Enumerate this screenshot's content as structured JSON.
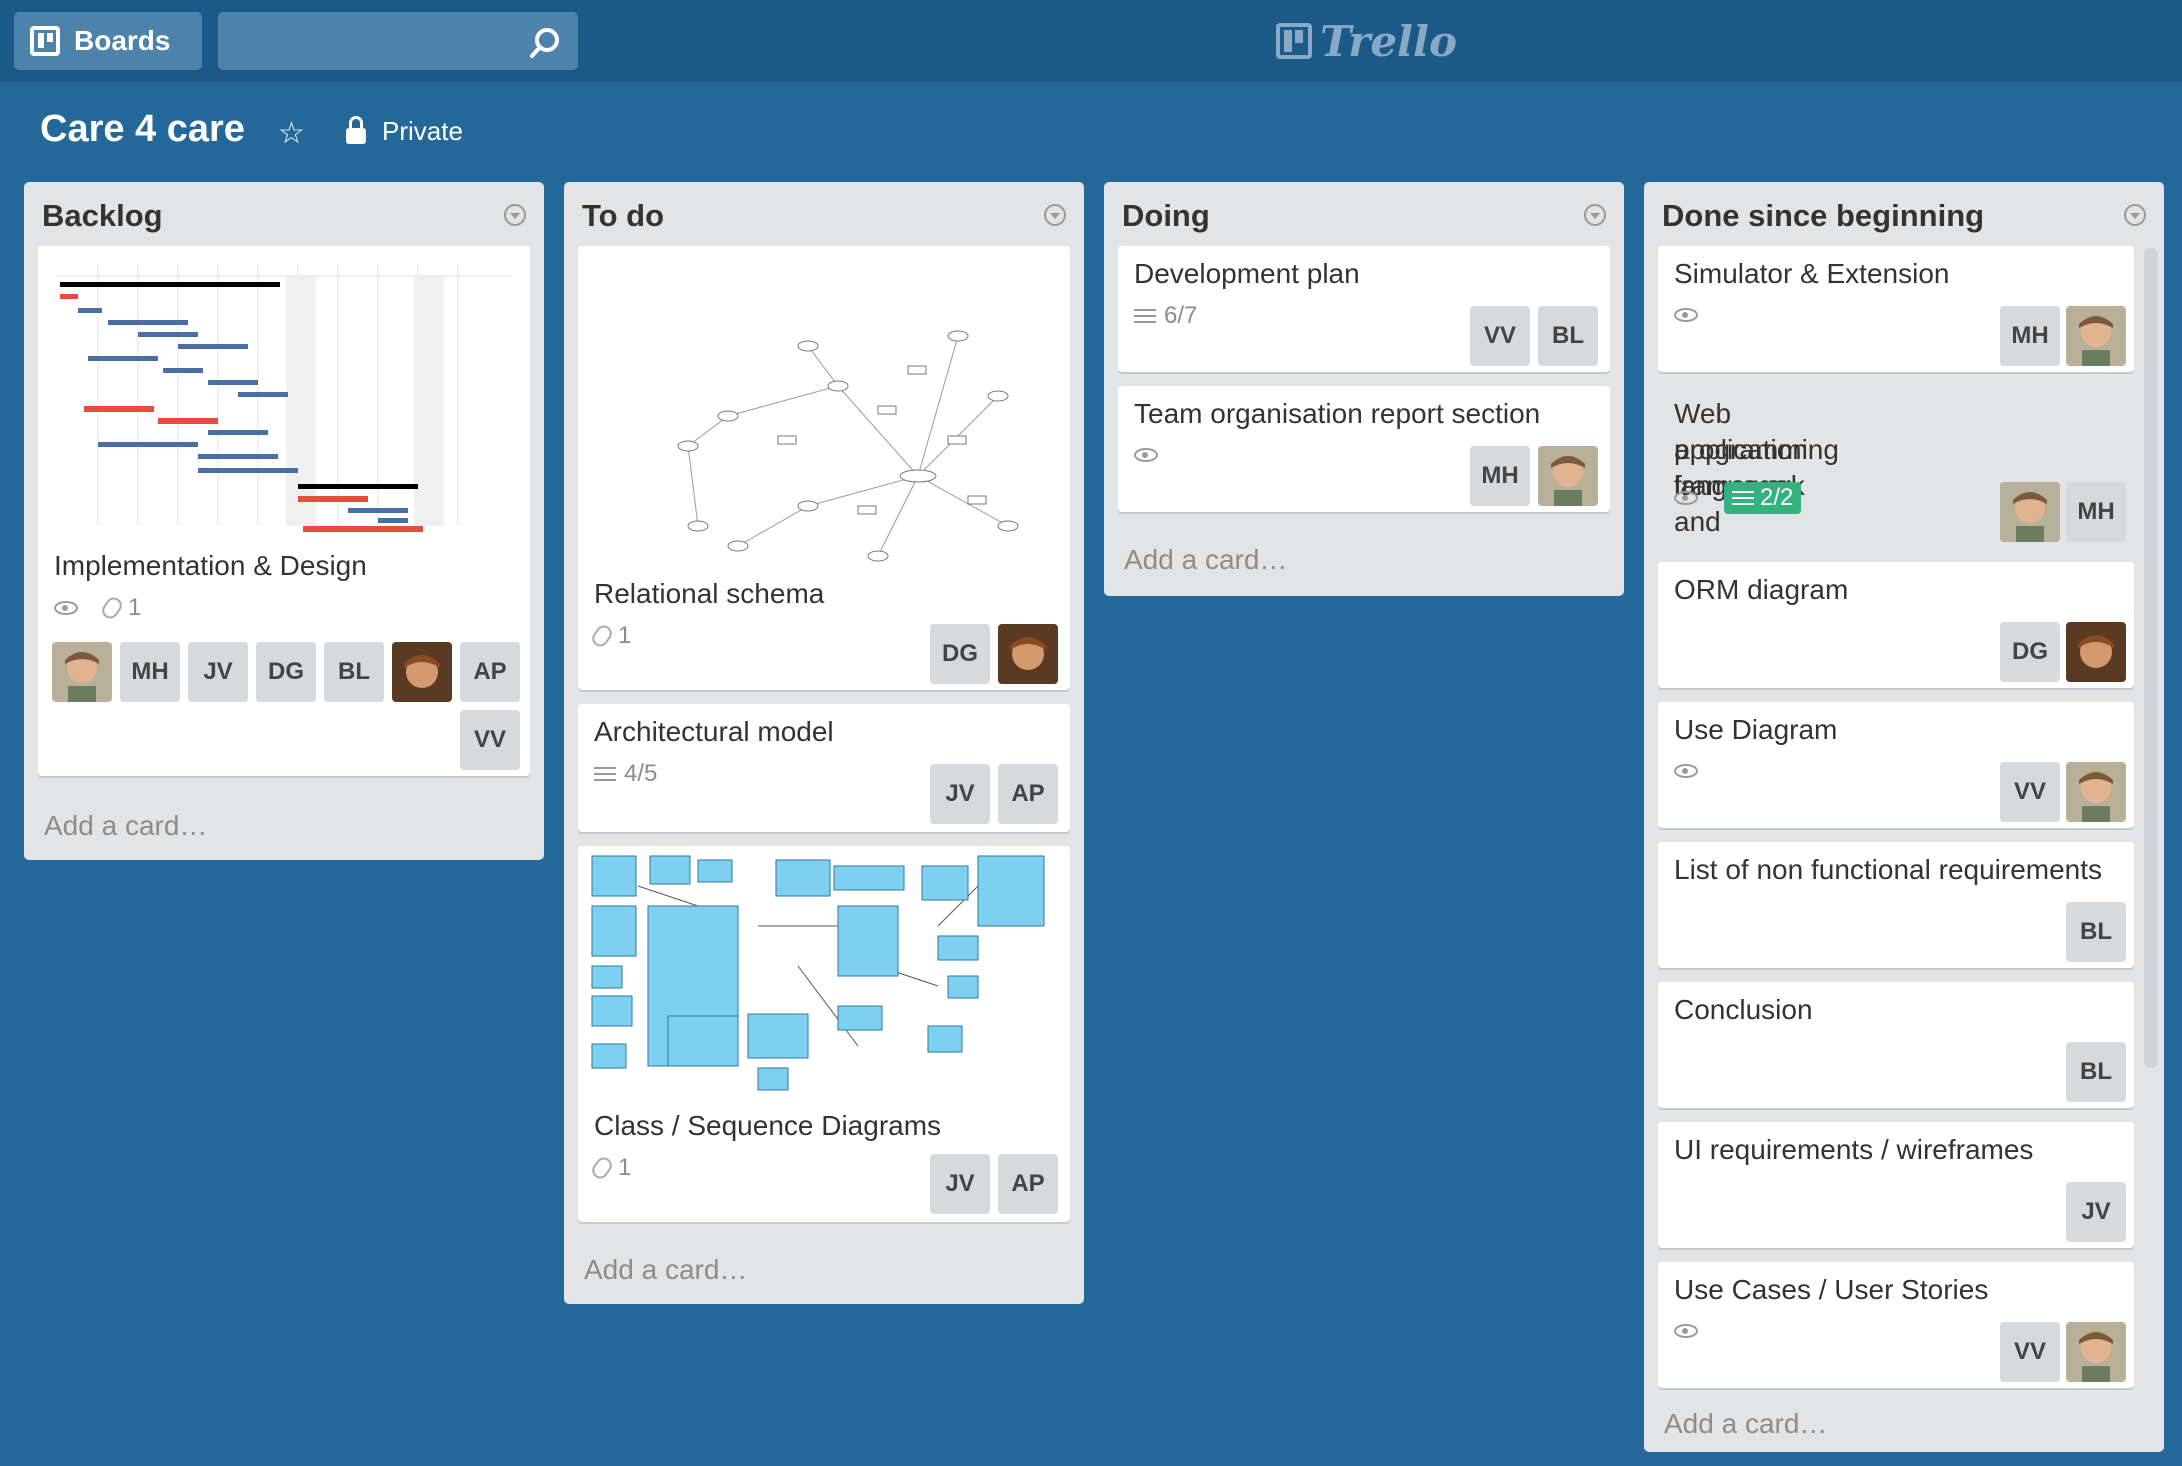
{
  "header": {
    "boards_label": "Boards",
    "search_placeholder": "",
    "logo_text": "Trello"
  },
  "board": {
    "title": "Care 4 care",
    "visibility": "Private"
  },
  "lists": [
    {
      "title": "Backlog",
      "add_card": "Add a card…",
      "cards": [
        {
          "title": "Implementation & Design",
          "attachments": "1",
          "members": [
            "MH",
            "JV",
            "DG",
            "BL",
            "AP",
            "VV"
          ]
        }
      ]
    },
    {
      "title": "To do",
      "add_card": "Add a card…",
      "cards": [
        {
          "title": "Relational schema",
          "attachments": "1",
          "members": [
            "DG"
          ]
        },
        {
          "title": "Architectural model",
          "checklist": "4/5",
          "members": [
            "JV",
            "AP"
          ]
        },
        {
          "title": "Class / Sequence Diagrams",
          "attachments": "1",
          "members": [
            "JV",
            "AP"
          ]
        }
      ]
    },
    {
      "title": "Doing",
      "add_card": "Add a card…",
      "cards": [
        {
          "title": "Development plan",
          "checklist": "6/7",
          "members": [
            "VV",
            "BL"
          ]
        },
        {
          "title": "Team organisation report section",
          "members": [
            "MH"
          ]
        }
      ]
    },
    {
      "title": "Done since beginning",
      "add_card": "Add a card…",
      "cards": [
        {
          "title": "Simulator & Extension",
          "members": [
            "MH"
          ]
        },
        {
          "title": "Web application framework and",
          "title2": "programming language",
          "checklist": "2/2",
          "members": [
            "MH"
          ]
        },
        {
          "title": "ORM diagram",
          "members": [
            "DG"
          ]
        },
        {
          "title": "Use Diagram",
          "members": [
            "VV"
          ]
        },
        {
          "title": "List of non functional requirements",
          "members": [
            "BL"
          ]
        },
        {
          "title": "Conclusion",
          "members": [
            "BL"
          ]
        },
        {
          "title": "UI requirements / wireframes",
          "members": [
            "JV"
          ]
        },
        {
          "title": "Use Cases / User Stories",
          "members": [
            "VV"
          ]
        }
      ]
    }
  ],
  "colors": {
    "board_bg": "#24689a",
    "header_bg": "#1b5a88",
    "list_bg": "#e2e4e6",
    "checklist_complete": "#34b27d",
    "label_red": "#e74c3c",
    "diagram_blue": "#7fd0f0"
  },
  "icons": [
    "boards-icon",
    "search-icon",
    "trello-logo-icon",
    "star-icon",
    "lock-icon",
    "list-menu-icon",
    "eye-icon",
    "paperclip-icon",
    "checklist-icon"
  ]
}
